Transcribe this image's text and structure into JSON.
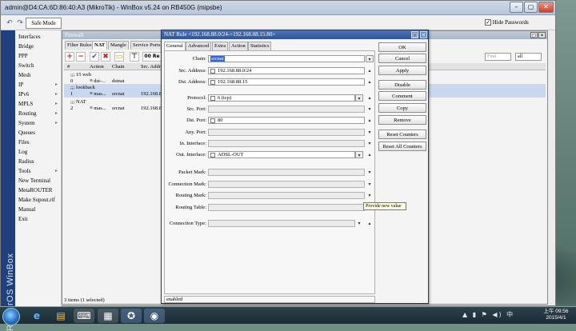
{
  "window": {
    "title": "admin@D4:CA:6D:86:40:A3 (MikroTik) - WinBox v5.24 on RB450G (mipsbe)",
    "minimize_glyph": "–",
    "maximize_glyph": "▢",
    "close_glyph": "✕"
  },
  "toolbar": {
    "undo_glyph": "↶",
    "redo_glyph": "↷",
    "safe_mode": "Safe Mode",
    "hide_passwords": "Hide Passwords",
    "hide_passwords_check": "✓"
  },
  "sidebar": {
    "brand": "RouterOS WinBox",
    "items": [
      {
        "label": "Interfaces",
        "arrow": ""
      },
      {
        "label": "Bridge",
        "arrow": ""
      },
      {
        "label": "PPP",
        "arrow": ""
      },
      {
        "label": "Switch",
        "arrow": ""
      },
      {
        "label": "Mesh",
        "arrow": ""
      },
      {
        "label": "IP",
        "arrow": "▸"
      },
      {
        "label": "IPv6",
        "arrow": "▸"
      },
      {
        "label": "MPLS",
        "arrow": "▸"
      },
      {
        "label": "Routing",
        "arrow": "▸"
      },
      {
        "label": "System",
        "arrow": "▸"
      },
      {
        "label": "Queues",
        "arrow": ""
      },
      {
        "label": "Files",
        "arrow": ""
      },
      {
        "label": "Log",
        "arrow": ""
      },
      {
        "label": "Radius",
        "arrow": ""
      },
      {
        "label": "Tools",
        "arrow": "▸"
      },
      {
        "label": "New Terminal",
        "arrow": ""
      },
      {
        "label": "MetaROUTER",
        "arrow": ""
      },
      {
        "label": "Make Supout.rif",
        "arrow": ""
      },
      {
        "label": "Manual",
        "arrow": ""
      },
      {
        "label": "Exit",
        "arrow": ""
      }
    ]
  },
  "firewall": {
    "title": "Firewall",
    "tabs": [
      "Filter Rules",
      "NAT",
      "Mangle",
      "Service Ports"
    ],
    "tools": {
      "add": "+",
      "remove": "−",
      "enable": "✔",
      "disable": "✖",
      "comment": "▭",
      "filter": "⊤",
      "reset": "00 Re"
    },
    "find_placeholder": "Find",
    "all_value": "all",
    "columns": [
      "#",
      "Action",
      "Chain",
      "Src. Address"
    ],
    "rows": [
      {
        "type": "comment",
        "text": ";;; 15 web"
      },
      {
        "type": "rule",
        "num": "0",
        "action": "≡ dst-...",
        "chain": "dstnat",
        "src": "",
        "selected": false
      },
      {
        "type": "comment",
        "text": ";;; lookback",
        "selected": true
      },
      {
        "type": "rule",
        "num": "1",
        "action": "≡ mas...",
        "chain": "srcnat",
        "src": "192.168.8",
        "selected": true
      },
      {
        "type": "comment",
        "text": ";;; NAT"
      },
      {
        "type": "rule",
        "num": "2",
        "action": "≡ mas...",
        "chain": "srcnat",
        "src": "192.168.8",
        "selected": false
      }
    ],
    "status": "3 items (1 selected)"
  },
  "nat_rule": {
    "title": "NAT Rule <192.168.88.0/24->192.168.88.15:80>",
    "tabs": [
      "General",
      "Advanced",
      "Extra",
      "Action",
      "Statistics"
    ],
    "active_tab": "General",
    "fields": {
      "chain": {
        "label": "Chain:",
        "value": "srcnat"
      },
      "src_address": {
        "label": "Src. Address:",
        "value": "192.168.88.0/24"
      },
      "dst_address": {
        "label": "Dst. Address:",
        "value": "192.168.88.15"
      },
      "protocol": {
        "label": "Protocol:",
        "value": "6 (tcp)"
      },
      "src_port": {
        "label": "Src. Port:",
        "value": ""
      },
      "dst_port": {
        "label": "Dst. Port:",
        "value": "80"
      },
      "any_port": {
        "label": "Any. Port:",
        "value": ""
      },
      "in_interface": {
        "label": "In. Interface:",
        "value": ""
      },
      "out_interface": {
        "label": "Out. Interface:",
        "value": "ADSL-OUT"
      },
      "packet_mark": {
        "label": "Packet Mark:",
        "value": ""
      },
      "connection_mark": {
        "label": "Connection Mark:",
        "value": ""
      },
      "routing_mark": {
        "label": "Routing Mark:",
        "value": ""
      },
      "routing_table": {
        "label": "Routing Table:",
        "value": ""
      },
      "connection_type": {
        "label": "Connection Type:",
        "value": ""
      }
    },
    "buttons": {
      "ok": "OK",
      "cancel": "Cancel",
      "apply": "Apply",
      "disable": "Disable",
      "comment": "Comment",
      "copy": "Copy",
      "remove": "Remove",
      "reset_counters": "Reset Counters",
      "reset_all_counters": "Reset All Counters"
    },
    "tooltip": "Provide new value",
    "status": "enabled"
  },
  "taskbar": {
    "apps": [
      "e",
      "▤",
      "⌨",
      "▦",
      "✪",
      "◉"
    ],
    "tray": "▲ ▮ ⚑ ◀) 中",
    "clock_time": "上午 09:56",
    "clock_date": "2015/4/1"
  }
}
